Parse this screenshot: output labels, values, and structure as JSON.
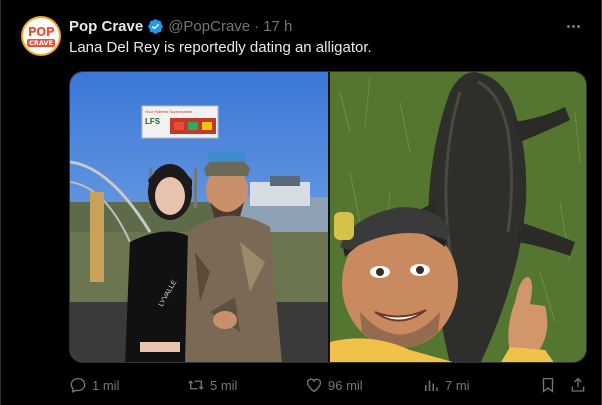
{
  "account": {
    "avatar_text_top": "POP",
    "avatar_text_bottom": "CRAVE",
    "display_name": "Pop Crave",
    "handle": "@PopCrave",
    "separator": "·",
    "time": "17 h",
    "verified_icon": "verified-badge-icon"
  },
  "tweet": {
    "text": "Lana Del Rey is reportedly dating an alligator."
  },
  "media": {
    "left_photo": {
      "billboard_line1": "Your Roberts Supermarket",
      "billboard_line2": "LFS",
      "shirt_text": "LYVALLE"
    },
    "right_photo": {}
  },
  "actions": {
    "replies": "1 mil",
    "reposts": "5 mil",
    "likes": "96 mil",
    "views": "7 mi"
  },
  "colors": {
    "background": "#000000",
    "text_primary": "#e7e9ea",
    "text_secondary": "#71767b",
    "verified": "#1d9bf0",
    "border": "#2f3336"
  }
}
